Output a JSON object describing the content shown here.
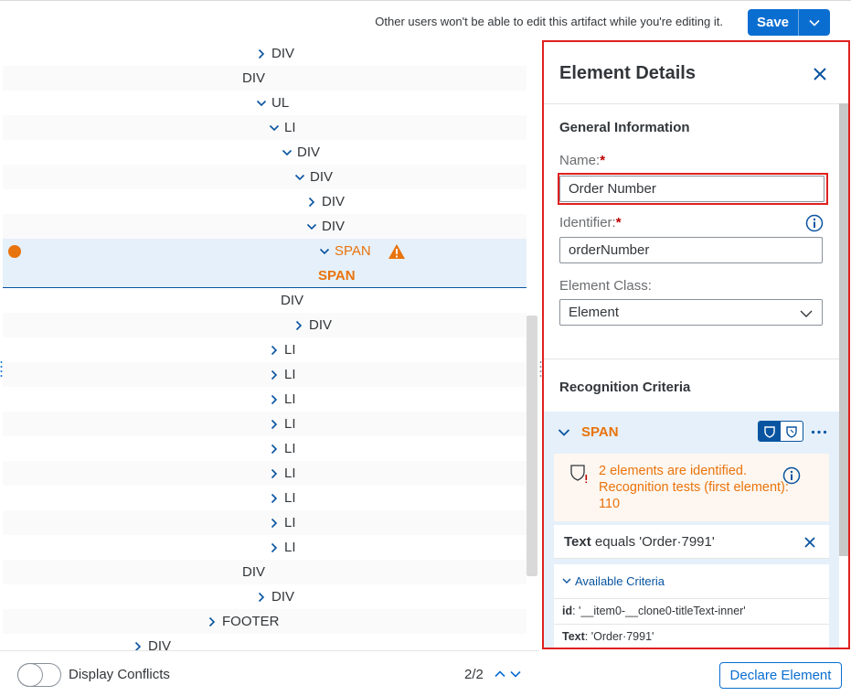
{
  "topbar": {
    "message": "Other users won't be able to edit this artifact while you're editing it.",
    "save_label": "Save"
  },
  "tree": {
    "rows": [
      {
        "label": "DIV",
        "chev": "right"
      },
      {
        "label": "DIV",
        "chev": "none"
      },
      {
        "label": "UL",
        "chev": "down"
      },
      {
        "label": "LI",
        "chev": "down"
      },
      {
        "label": "DIV",
        "chev": "down"
      },
      {
        "label": "DIV",
        "chev": "down"
      },
      {
        "label": "DIV",
        "chev": "right"
      },
      {
        "label": "DIV",
        "chev": "down"
      },
      {
        "label": "SPAN",
        "chev": "down"
      },
      {
        "label": "SPAN",
        "chev": "none"
      },
      {
        "label": "DIV",
        "chev": "none"
      },
      {
        "label": "DIV",
        "chev": "right"
      },
      {
        "label": "LI",
        "chev": "right"
      },
      {
        "label": "LI",
        "chev": "right"
      },
      {
        "label": "LI",
        "chev": "right"
      },
      {
        "label": "LI",
        "chev": "right"
      },
      {
        "label": "LI",
        "chev": "right"
      },
      {
        "label": "LI",
        "chev": "right"
      },
      {
        "label": "LI",
        "chev": "right"
      },
      {
        "label": "LI",
        "chev": "right"
      },
      {
        "label": "LI",
        "chev": "right"
      },
      {
        "label": "DIV",
        "chev": "none"
      },
      {
        "label": "DIV",
        "chev": "right"
      },
      {
        "label": "FOOTER",
        "chev": "right"
      },
      {
        "label": "DIV",
        "chev": "right"
      }
    ]
  },
  "bottombar": {
    "toggle_label": "Display Conflicts",
    "pager": "2/2"
  },
  "details": {
    "title": "Element Details",
    "general_title": "General Information",
    "name_label": "Name:",
    "name_value": "Order Number",
    "identifier_label": "Identifier:",
    "identifier_value": "orderNumber",
    "class_label": "Element Class:",
    "class_value": "Element",
    "required_mark": "*",
    "recognition_title": "Recognition Criteria",
    "criteria": {
      "element_label": "SPAN",
      "warning_text": "2 elements are identified. Recognition tests (first element): 110",
      "text_crit_key": "Text",
      "text_crit_rest": " equals 'Order·7991'",
      "available_title": "Available Criteria",
      "available": [
        {
          "key": "id",
          "value": ": '__item0-__clone0-titleText-inner'"
        },
        {
          "key": "Text",
          "value": ": 'Order·7991'"
        }
      ]
    },
    "declare_label": "Declare Element"
  },
  "colors": {
    "accent": "#0a6ed1",
    "warning": "#e9730c",
    "highlight": "#e02020"
  }
}
